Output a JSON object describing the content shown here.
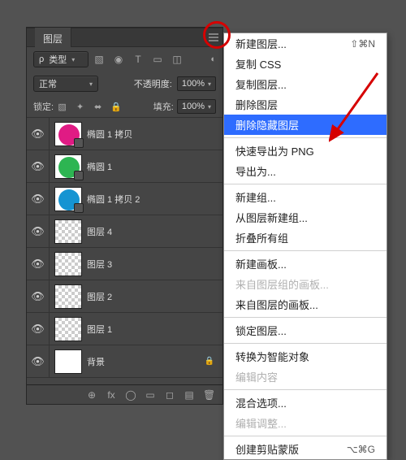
{
  "panel": {
    "tab": "图层",
    "kind": {
      "label": "类型",
      "icon": "ρ"
    },
    "filter_icons": [
      "▧",
      "◉",
      "T",
      "▭",
      "◫"
    ],
    "blend_mode": "正常",
    "opacity_label": "不透明度:",
    "opacity_value": "100%",
    "lock_label": "锁定:",
    "lock_icons": [
      "▧",
      "✦",
      "⬌",
      "🔒"
    ],
    "fill_label": "填充:",
    "fill_value": "100%",
    "footer_icons": [
      "⊕",
      "fx",
      "◯",
      "▭",
      "◻",
      "▤",
      "🗑"
    ]
  },
  "layers": [
    {
      "eye": true,
      "name": "椭圆 1 拷贝",
      "color": "#e01b84",
      "vector": true
    },
    {
      "eye": true,
      "name": "椭圆 1",
      "color": "#2db552",
      "vector": true
    },
    {
      "eye": true,
      "name": "椭圆 1 拷贝 2",
      "color": "#1594d2",
      "vector": true
    },
    {
      "eye": true,
      "name": "图层 4",
      "checker": true
    },
    {
      "eye": true,
      "name": "图层 3",
      "checker": true
    },
    {
      "eye": true,
      "name": "图层 2",
      "checker": true
    },
    {
      "eye": true,
      "name": "图层 1",
      "checker": true
    },
    {
      "eye": true,
      "name": "背景",
      "white": true,
      "locked": true
    }
  ],
  "menu": [
    {
      "label": "新建图层...",
      "shortcut": "⇧⌘N"
    },
    {
      "label": "复制 CSS"
    },
    {
      "label": "复制图层..."
    },
    {
      "label": "删除图层"
    },
    {
      "label": "删除隐藏图层",
      "highlight": true
    },
    {
      "sep": true
    },
    {
      "label": "快速导出为 PNG"
    },
    {
      "label": "导出为..."
    },
    {
      "sep": true
    },
    {
      "label": "新建组..."
    },
    {
      "label": "从图层新建组..."
    },
    {
      "label": "折叠所有组"
    },
    {
      "sep": true
    },
    {
      "label": "新建画板..."
    },
    {
      "label": "来自图层组的画板...",
      "disabled": true
    },
    {
      "label": "来自图层的画板..."
    },
    {
      "sep": true
    },
    {
      "label": "锁定图层..."
    },
    {
      "sep": true
    },
    {
      "label": "转换为智能对象"
    },
    {
      "label": "编辑内容",
      "disabled": true
    },
    {
      "sep": true
    },
    {
      "label": "混合选项..."
    },
    {
      "label": "编辑调整...",
      "disabled": true
    },
    {
      "sep": true
    },
    {
      "label": "创建剪贴蒙版",
      "shortcut": "⌥⌘G"
    }
  ]
}
